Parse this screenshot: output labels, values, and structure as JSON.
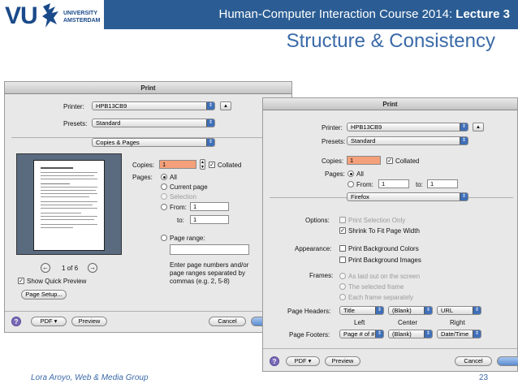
{
  "header": {
    "logo_vu": "VU",
    "logo_university": "UNIVERSITY",
    "logo_amsterdam": "AMSTERDAM",
    "course_prefix": "Human-Computer Interaction Course 2014: ",
    "course_lecture": "Lecture 3",
    "slide_title": "Structure & Consistency"
  },
  "footer": {
    "author": "Lora Aroyo, Web & Media Group",
    "page_number": "23"
  },
  "dialog_left": {
    "title": "Print",
    "printer_label": "Printer:",
    "printer_value": "HPB13CB9",
    "presets_label": "Presets:",
    "presets_value": "Standard",
    "section_value": "Copies & Pages",
    "copies_label": "Copies:",
    "copies_value": "1",
    "collated_label": "Collated",
    "pages_label": "Pages:",
    "pages_all": "All",
    "pages_current": "Current page",
    "pages_selection": "Selection",
    "pages_from": "From:",
    "pages_from_value": "1",
    "pages_to": "to:",
    "pages_to_value": "1",
    "page_range_label": "Page range:",
    "page_range_hint_1": "Enter page numbers and/or",
    "page_range_hint_2": "page ranges separated by",
    "page_range_hint_3": "commas (e.g. 2, 5-8)",
    "preview_page_info": "1 of 6",
    "show_quick_preview": "Show Quick Preview",
    "page_setup_button": "Page Setup...",
    "help_button": "?",
    "pdf_button": "PDF ▾",
    "preview_button": "Preview",
    "cancel_button": "Cancel"
  },
  "dialog_right": {
    "title": "Print",
    "printer_label": "Printer:",
    "printer_value": "HPB13CB9",
    "presets_label": "Presets:",
    "presets_value": "Standard",
    "copies_label": "Copies:",
    "copies_value": "1",
    "collated_label": "Collated",
    "pages_label": "Pages:",
    "pages_all": "All",
    "pages_from": "From:",
    "pages_from_value": "1",
    "pages_to": "to:",
    "pages_to_value": "1",
    "section_value": "Firefox",
    "options_label": "Options:",
    "opt_print_selection": "Print Selection Only",
    "opt_shrink": "Shrink To Fit Page Width",
    "appearance_label": "Appearance:",
    "app_bg_colors": "Print Background Colors",
    "app_bg_images": "Print Background Images",
    "frames_label": "Frames:",
    "frames_laid_out": "As laid out on the screen",
    "frames_selected": "The selected frame",
    "frames_each": "Each frame separately",
    "page_headers_label": "Page Headers:",
    "header_left": "Title",
    "header_center": "(Blank)",
    "header_right": "URL",
    "col_left": "Left",
    "col_center": "Center",
    "col_right": "Right",
    "page_footers_label": "Page Footers:",
    "footer_left": "Page # of #",
    "footer_center": "(Blank)",
    "footer_right": "Date/Time",
    "help_button": "?",
    "pdf_button": "PDF ▾",
    "preview_button": "Preview",
    "cancel_button": "Cancel"
  },
  "colors": {
    "header_bar": "#2b5d94",
    "title_blue": "#3a6aa8",
    "popup_arrow": "#3f6fb8",
    "copies_highlight": "#f4a07a"
  }
}
